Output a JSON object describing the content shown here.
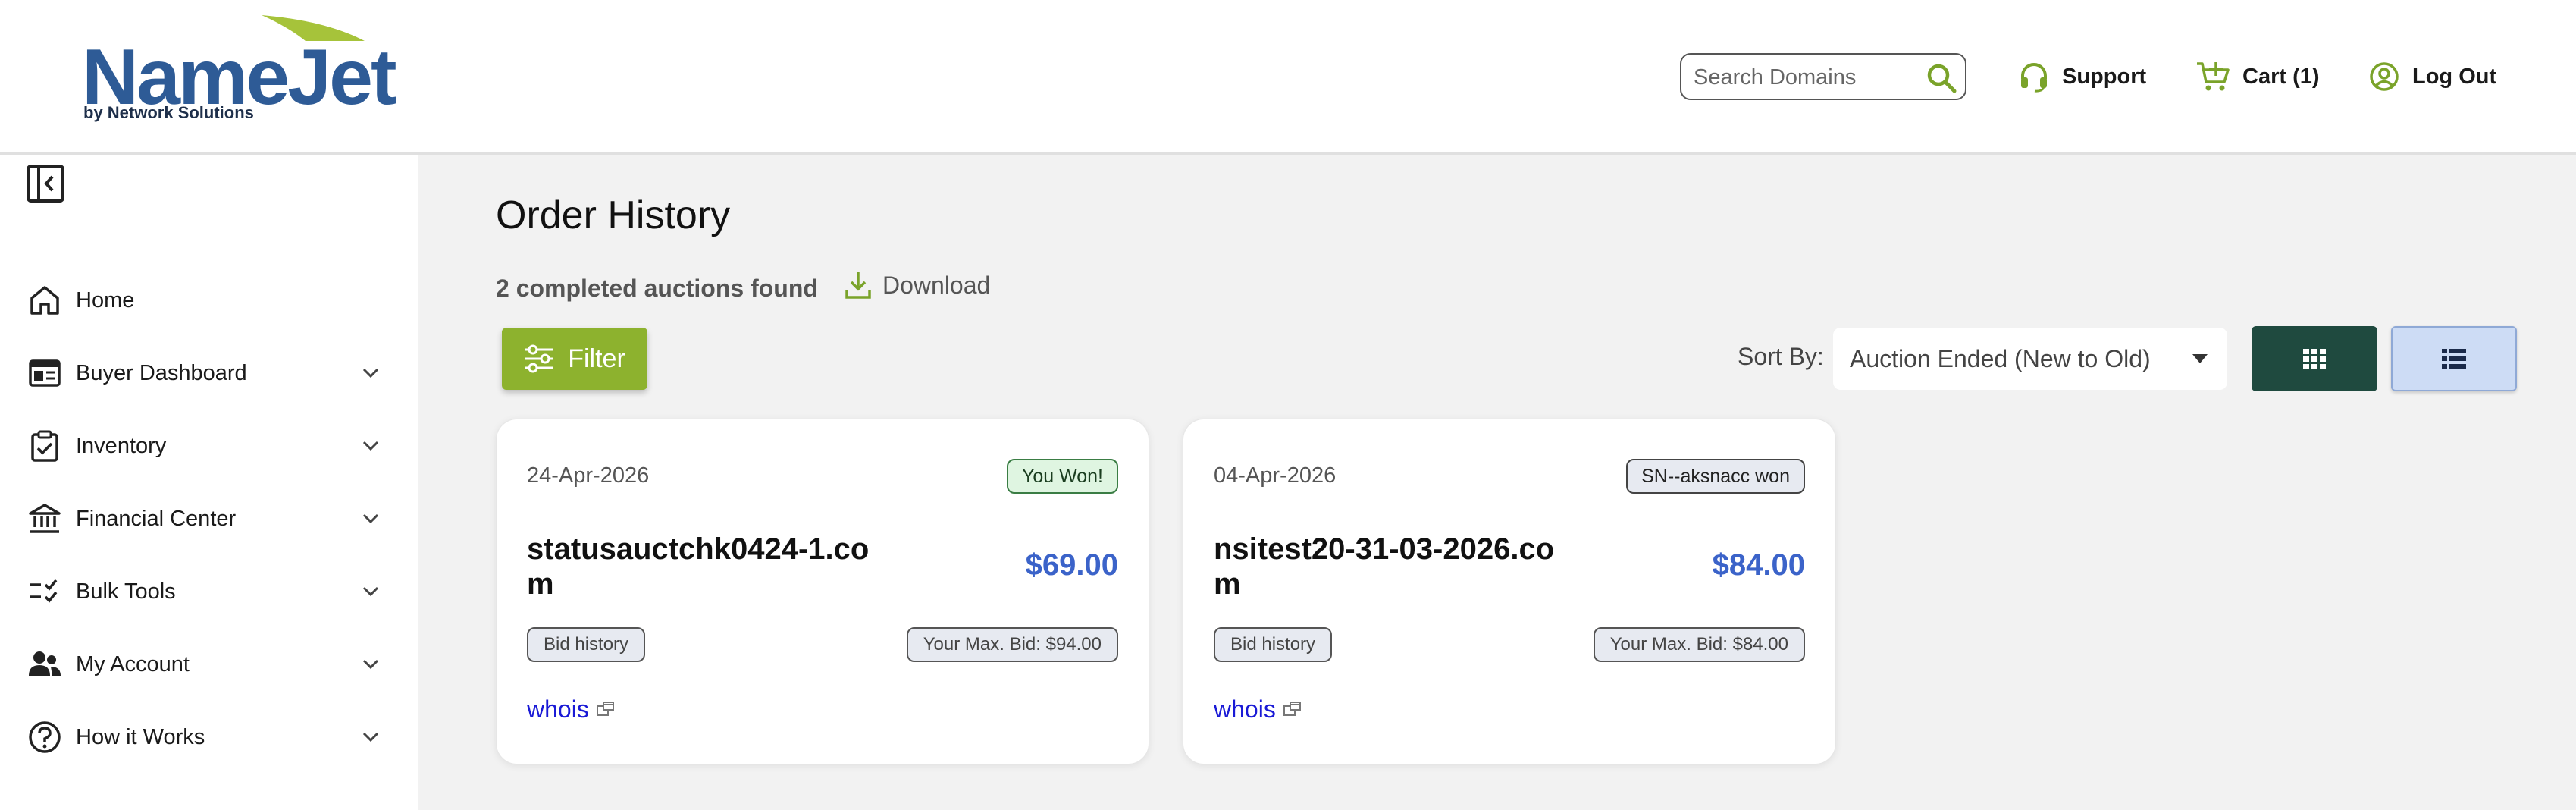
{
  "header": {
    "logo_text": "NameJet",
    "logo_sub": "by Network Solutions",
    "search_placeholder": "Search Domains",
    "support_label": "Support",
    "cart_label": "Cart (1)",
    "logout_label": "Log Out"
  },
  "sidebar": {
    "items": [
      {
        "label": "Home",
        "icon": "home-icon"
      },
      {
        "label": "Buyer Dashboard",
        "icon": "dashboard-icon"
      },
      {
        "label": "Inventory",
        "icon": "clipboard-icon"
      },
      {
        "label": "Financial Center",
        "icon": "bank-icon"
      },
      {
        "label": "Bulk Tools",
        "icon": "checklist-icon"
      },
      {
        "label": "My Account",
        "icon": "users-icon"
      },
      {
        "label": "How it Works",
        "icon": "question-icon"
      }
    ]
  },
  "main": {
    "title": "Order History",
    "result_count": "2 completed auctions found",
    "download_label": "Download",
    "filter_label": "Filter",
    "sort_label": "Sort By:",
    "sort_value": "Auction Ended (New to Old)"
  },
  "cards": [
    {
      "date": "24-Apr-2026",
      "status": "You Won!",
      "domain": "statusauctchk0424-1.com",
      "price": "$69.00",
      "bid_history": "Bid history",
      "max_bid": "Your Max. Bid: $94.00",
      "whois": "whois"
    },
    {
      "date": "04-Apr-2026",
      "status": "SN--aksnacc won",
      "domain": "nsitest20-31-03-2026.com",
      "price": "$84.00",
      "bid_history": "Bid history",
      "max_bid": "Your Max. Bid: $84.00",
      "whois": "whois"
    }
  ],
  "colors": {
    "brand_blue": "#2e5b96",
    "brand_green": "#8db22e",
    "price_blue": "#3b63c9",
    "grid_button": "#1f4a3f",
    "list_button": "#cddcf5"
  }
}
